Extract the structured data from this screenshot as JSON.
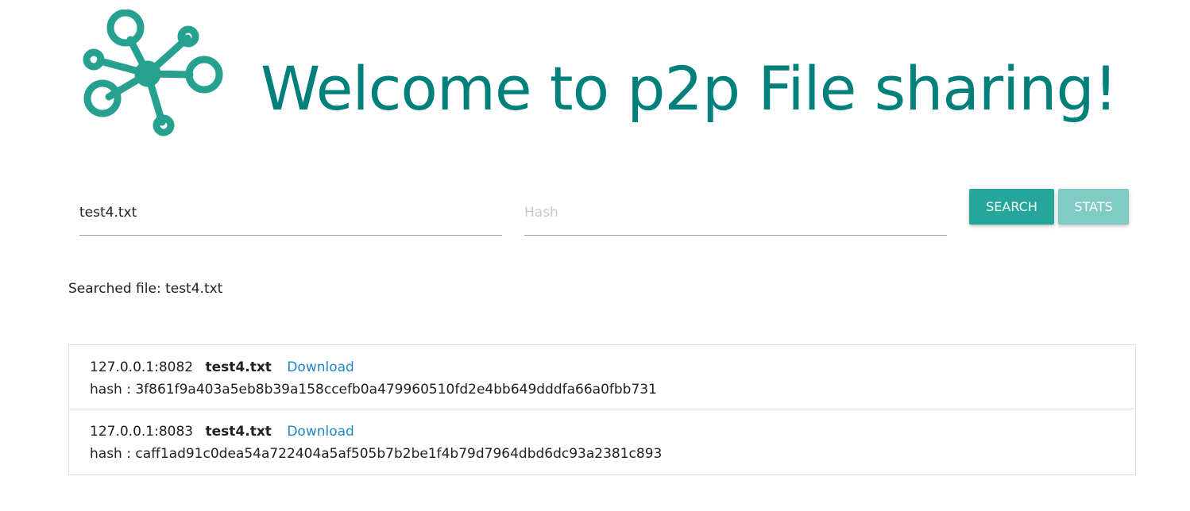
{
  "header": {
    "title": "Welcome to p2p File sharing!",
    "logo_icon": "network-nodes-icon",
    "logo_color": "#26a18f",
    "title_color": "#00807a"
  },
  "search": {
    "name_value": "test4.txt",
    "name_placeholder": "",
    "hash_value": "",
    "hash_placeholder": "Hash",
    "search_label": "SEARCH",
    "stats_label": "STATS",
    "search_color": "#26a69a",
    "stats_color": "#80cbc4"
  },
  "status": {
    "searched_text": "Searched file: test4.txt"
  },
  "results": [
    {
      "address": "127.0.0.1:8082",
      "filename": "test4.txt",
      "download_label": "Download",
      "hash_line": "hash : 3f861f9a403a5eb8b39a158ccefb0a479960510fd2e4bb649dddfa66a0fbb731"
    },
    {
      "address": "127.0.0.1:8083",
      "filename": "test4.txt",
      "download_label": "Download",
      "hash_line": "hash : caff1ad91c0dea54a722404a5af505b7b2be1f4b79d7964dbd6dc93a2381c893"
    }
  ]
}
